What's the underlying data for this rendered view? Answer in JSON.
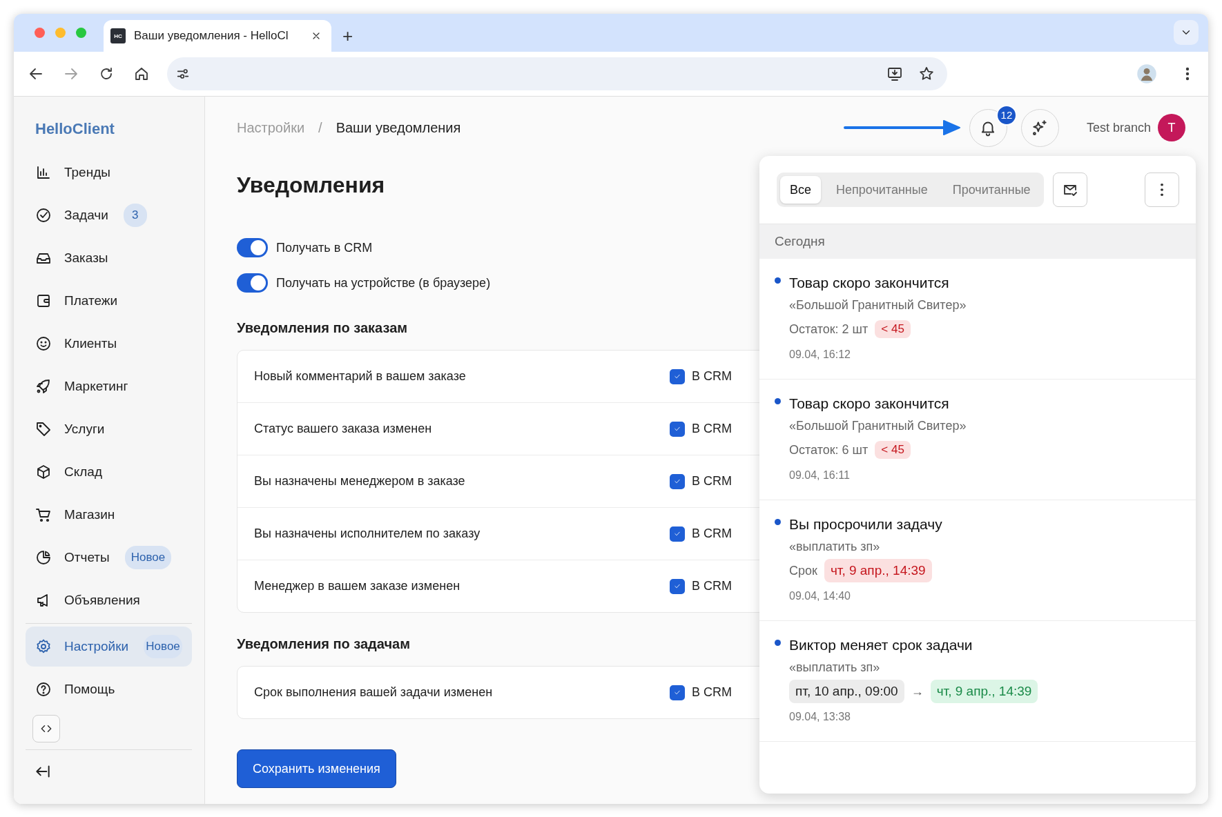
{
  "browser": {
    "tab": {
      "favicon": "HC",
      "title": "Ваши уведомления - HelloCl"
    },
    "new_tab": "+"
  },
  "sidebar": {
    "logo": "HelloClient",
    "groups": [
      {
        "items": [
          {
            "label": "Тренды",
            "selected": false
          },
          {
            "label": "Задачи",
            "badge": "3",
            "selected": false
          },
          {
            "label": "Заказы",
            "selected": false
          },
          {
            "label": "Платежи",
            "selected": false
          },
          {
            "label": "Клиенты",
            "selected": false
          },
          {
            "label": "Маркетинг",
            "selected": false
          },
          {
            "label": "Услуги",
            "selected": false
          },
          {
            "label": "Склад",
            "selected": false
          },
          {
            "label": "Магазин",
            "selected": false
          },
          {
            "label": "Отчеты",
            "badge": "Новое",
            "selected": false
          },
          {
            "label": "Объявления",
            "selected": false
          }
        ]
      },
      {
        "items": [
          {
            "label": "Настройки",
            "badge": "Новое",
            "selected": true
          },
          {
            "label": "Помощь",
            "selected": false
          }
        ]
      }
    ]
  },
  "header": {
    "breadcrumbs": [
      "Настройки",
      "Ваши уведомления"
    ],
    "separator": "/",
    "notification_count": "12",
    "branch": "Test branch",
    "avatar": "T"
  },
  "page": {
    "title": "Уведомления",
    "toggles": [
      {
        "label": "Получать в CRM",
        "on": true
      },
      {
        "label": "Получать на устройстве (в браузере)",
        "on": true
      }
    ],
    "sections": [
      {
        "title": "Уведомления по заказам",
        "rows": [
          {
            "label": "Новый комментарий в вашем заказе",
            "checked": true,
            "check_label": "В CRM"
          },
          {
            "label": "Статус вашего заказа изменен",
            "checked": true,
            "check_label": "В CRM"
          },
          {
            "label": "Вы назначены менеджером в заказе",
            "checked": true,
            "check_label": "В CRM"
          },
          {
            "label": "Вы назначены исполнителем по заказу",
            "checked": true,
            "check_label": "В CRM"
          },
          {
            "label": "Менеджер в вашем заказе изменен",
            "checked": true,
            "check_label": "В CRM"
          }
        ]
      },
      {
        "title": "Уведомления по задачам",
        "rows": [
          {
            "label": "Срок выполнения вашей задачи изменен",
            "checked": true,
            "check_label": "В CRM"
          }
        ]
      }
    ],
    "save_button": "Сохранить изменения"
  },
  "notifications_panel": {
    "tabs": [
      {
        "label": "Все",
        "selected": true
      },
      {
        "label": "Непрочитанные",
        "selected": false
      },
      {
        "label": "Прочитанные",
        "selected": false
      }
    ],
    "group": "Сегодня",
    "items": [
      {
        "kind": "limit",
        "unread": true,
        "title": "Товар скоро закончится",
        "subtitle": "«Большой Гранитный Свитер»",
        "label": "Остаток: 2 шт",
        "tag": "< 45",
        "time": "09.04, 16:12"
      },
      {
        "kind": "limit",
        "unread": true,
        "title": "Товар скоро закончится",
        "subtitle": "«Большой Гранитный Свитер»",
        "label": "Остаток: 6 шт",
        "tag": "< 45",
        "time": "09.04, 16:11"
      },
      {
        "kind": "deadline",
        "unread": true,
        "title": "Вы просрочили задачу",
        "subtitle": "«выплатить зп»",
        "label": "Срок",
        "tag": "чт, 9 апр., 14:39",
        "time": "09.04, 14:40"
      },
      {
        "kind": "change",
        "unread": true,
        "title": "Виктор меняет срок задачи",
        "subtitle": "«выплатить зп»",
        "from": "пт, 10 апр., 09:00",
        "arrow": "→",
        "to": "чт, 9 апр., 14:39",
        "time": "09.04, 13:38"
      }
    ]
  }
}
